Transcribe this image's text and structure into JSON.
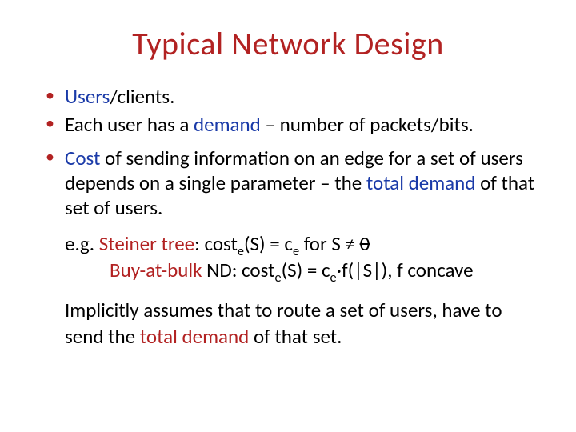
{
  "title": "Typical Network Design",
  "b1": {
    "users": "Users",
    "clients": "/clients."
  },
  "b2": {
    "t1": "Each user has a ",
    "demand": "demand",
    "t2": " – number of packets/bits."
  },
  "b3": {
    "cost": "Cost",
    "t1": " of sending information on an edge for a set of users depends on a single parameter – the ",
    "total_demand": "total demand",
    "t2": " of that set of users."
  },
  "ex": {
    "lead": "e.g. ",
    "steiner": "Steiner tree",
    "st_colon": ": ",
    "cost_e": "cost",
    "e_sub": "e",
    "st_eq": "(S) = c",
    "st_tail": " for S ≠ ",
    "emptyset": "0",
    "bab": "Buy-at-bulk",
    "bab_tail1": " ND: ",
    "bab_eq": "(S) = c",
    "bab_dotf": "·f(|S|),  f concave"
  },
  "imp": {
    "t1": "Implicitly assumes that to route a set of users, have to send the ",
    "td": "total demand",
    "t2": " of that set."
  }
}
